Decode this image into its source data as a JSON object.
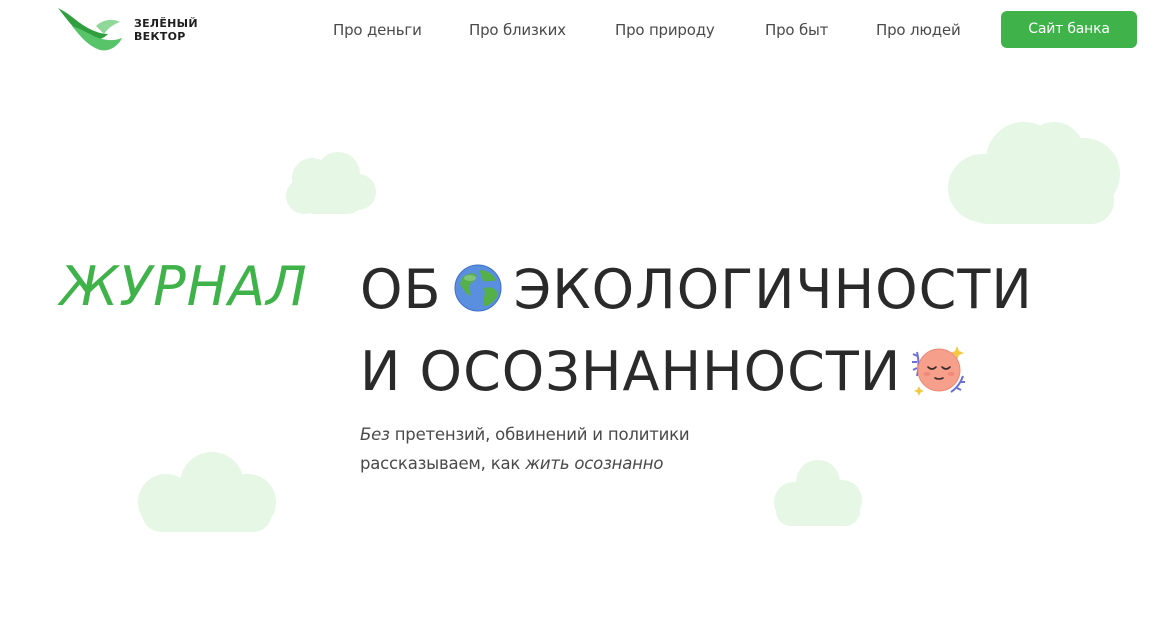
{
  "brand": {
    "name_line1": "ЗЕЛЁНЫЙ",
    "name_line2": "ВЕКТОР",
    "accent_color": "#3fb24a",
    "icon": "bird-logo-icon"
  },
  "nav": {
    "items": [
      {
        "label": "Про деньги"
      },
      {
        "label": "Про близких"
      },
      {
        "label": "Про природу"
      },
      {
        "label": "Про быт"
      },
      {
        "label": "Про людей"
      }
    ],
    "cta_label": "Сайт банка"
  },
  "hero": {
    "accent_word": "ЖУРНАЛ",
    "line1_word1": "ОБ",
    "line1_word2": "ЭКОЛОГИЧНОСТИ",
    "line2_word": "И ОСОЗНАННОСТИ",
    "emoji_1": "globe-emoji",
    "emoji_2": "calm-face-emoji"
  },
  "subtitle": {
    "line1_em": "Без",
    "line1_rest": " претензий, обвинений и политики",
    "line2_start": "рассказываем, как ",
    "line2_em": "жить осознанно"
  },
  "colors": {
    "cloud": "#e6f7e6",
    "text": "#2a2a2a",
    "button_bg": "#3fb24a"
  }
}
